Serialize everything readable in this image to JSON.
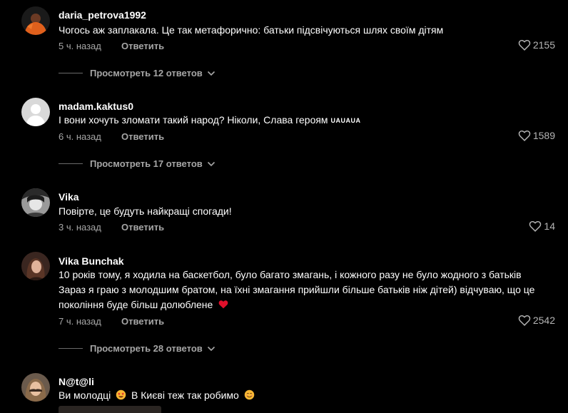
{
  "heart_icon": "heart-outline-icon",
  "chevron_icon": "chevron-down-icon",
  "colors": {
    "background": "#000000",
    "text": "#ffffff",
    "muted": "#a6a6a6",
    "like_count": "#b5b5b5",
    "heart_emoji": "#e0102b"
  },
  "comments": [
    {
      "username": "daria_petrova1992",
      "text": "Чогось аж заплакала. Це так метафорично: батьки підсвічуються шлях своїм дітям",
      "time": "5 ч. назад",
      "reply_label": "Ответить",
      "likes": "2155",
      "view_replies": "Просмотреть 12 ответов"
    },
    {
      "username": "madam.kaktus0",
      "text": "І вони хочуть зломати такий народ? Ніколи, Слава героям",
      "flags": "UAUAUA",
      "time": "6 ч. назад",
      "reply_label": "Ответить",
      "likes": "1589",
      "view_replies": "Просмотреть 17 ответов"
    },
    {
      "username": "Vika",
      "text": "Повірте, це будуть найкращі спогади!",
      "time": "3 ч. назад",
      "reply_label": "Ответить",
      "likes": "14"
    },
    {
      "username": "Vika Bunchak",
      "text_line1": "10 років тому, я ходила на баскетбол, було багато змагань, і кожного разу не було жодного з батьків",
      "text_line2": "Зараз я граю з молодшим братом, на їхні змагання прийшли більше батьків ніж дітей) відчуваю, що це",
      "text_line3": "покоління буде більш долюблене",
      "time": "7 ч. назад",
      "reply_label": "Ответить",
      "likes": "2542",
      "view_replies": "Просмотреть 28 ответов"
    },
    {
      "username": "N@t@li",
      "text_part1": "Ви молодці",
      "text_part2": "В Києві теж так робимо"
    }
  ]
}
